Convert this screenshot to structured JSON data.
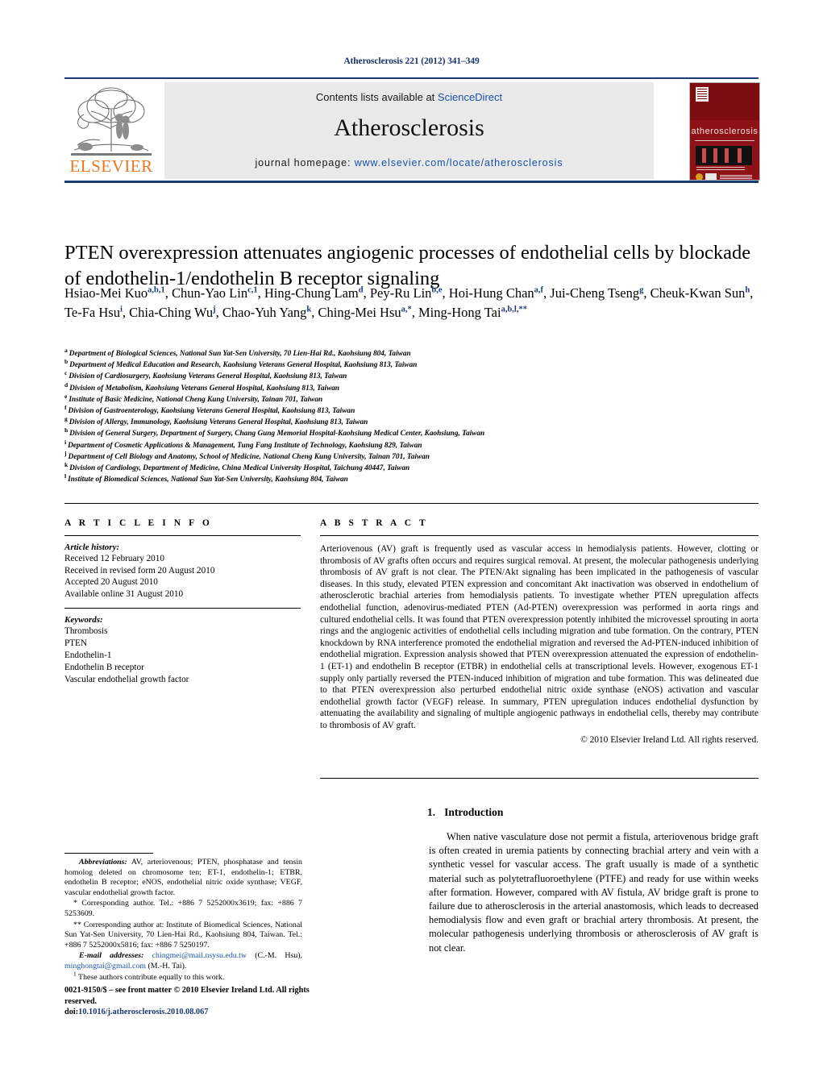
{
  "running_head": "Atherosclerosis 221 (2012) 341–349",
  "masthead": {
    "contents_prefix": "Contents lists available at",
    "sciencedirect": "ScienceDirect",
    "journal_name": "Atherosclerosis",
    "homepage_prefix": "journal homepage:",
    "homepage_url": "www.elsevier.com/locate/atherosclerosis",
    "publisher": "ELSEVIER",
    "cover_title": "atherosclerosis",
    "accent_blue": "#1a52a8",
    "rule_navy": "#1a3a73",
    "cover_red": "#8d1116",
    "elsevier_orange": "#E87722"
  },
  "article": {
    "title": "PTEN overexpression attenuates angiogenic processes of endothelial cells by blockade of endothelin-1/endothelin B receptor signaling",
    "authors": [
      {
        "name": "Hsiao-Mei Kuo",
        "sup": "a,b,1",
        "sep": ","
      },
      {
        "name": "Chun-Yao Lin",
        "sup": "c,1",
        "sep": ","
      },
      {
        "name": "Hing-Chung Lam",
        "sup": "d",
        "sep": ","
      },
      {
        "name": "Pey-Ru Lin",
        "sup": "b,e",
        "sep": ","
      },
      {
        "name": "Hoi-Hung Chan",
        "sup": "a,f",
        "sep": ","
      },
      {
        "name": "Jui-Cheng Tseng",
        "sup": "g",
        "sep": ","
      },
      {
        "name": "Cheuk-Kwan Sun",
        "sup": "h",
        "sep": ","
      },
      {
        "name": "Te-Fa Hsu",
        "sup": "i",
        "sep": ","
      },
      {
        "name": "Chia-Ching Wu",
        "sup": "j",
        "sep": ","
      },
      {
        "name": "Chao-Yuh Yang",
        "sup": "k",
        "sep": ","
      },
      {
        "name": "Ching-Mei Hsu",
        "sup": "a,*",
        "sep": ","
      },
      {
        "name": "Ming-Hong Tai",
        "sup": "a,b,l,**",
        "sep": ""
      }
    ],
    "affiliations": [
      {
        "marker": "a",
        "text": "Department of Biological Sciences, National Sun Yat-Sen University, 70 Lien-Hai Rd., Kaohsiung 804, Taiwan"
      },
      {
        "marker": "b",
        "text": "Department of Medical Education and Research, Kaohsiung Veterans General Hospital, Kaohsiung 813, Taiwan"
      },
      {
        "marker": "c",
        "text": "Division of Cardiosurgery, Kaohsiung Veterans General Hospital, Kaohsiung 813, Taiwan"
      },
      {
        "marker": "d",
        "text": "Division of Metabolism, Kaohsiung Veterans General Hospital, Kaohsiung 813, Taiwan"
      },
      {
        "marker": "e",
        "text": "Institute of Basic Medicine, National Cheng Kung University, Tainan 701, Taiwan"
      },
      {
        "marker": "f",
        "text": "Division of Gastroenterology, Kaohsiung Veterans General Hospital, Kaohsiung 813, Taiwan"
      },
      {
        "marker": "g",
        "text": "Division of Allergy, Immunology, Kaohsiung Veterans General Hospital, Kaohsiung 813, Taiwan"
      },
      {
        "marker": "h",
        "text": "Division of General Surgery, Department of Surgery, Chang Gung Memorial Hospital-Kaohsiung Medical Center, Kaohsiung, Taiwan"
      },
      {
        "marker": "i",
        "text": "Department of Cosmetic Applications & Management, Tung Fang Institute of Technology, Kaohsiung 829, Taiwan"
      },
      {
        "marker": "j",
        "text": "Department of Cell Biology and Anatomy, School of Medicine, National Cheng Kung University, Tainan 701, Taiwan"
      },
      {
        "marker": "k",
        "text": "Division of Cardiology, Department of Medicine, China Medical University Hospital, Taichung 40447, Taiwan"
      },
      {
        "marker": "l",
        "text": "Institute of Biomedical Sciences, National Sun Yat-Sen University, Kaohsiung 804, Taiwan"
      }
    ]
  },
  "article_info": {
    "heading": "A R T I C L E   I N F O",
    "history_label": "Article history:",
    "history": [
      "Received 12 February 2010",
      "Received in revised form 20 August 2010",
      "Accepted 20 August 2010",
      "Available online 31 August 2010"
    ],
    "keywords_label": "Keywords:",
    "keywords": [
      "Thrombosis",
      "PTEN",
      "Endothelin-1",
      "Endothelin B receptor",
      "Vascular endothelial growth factor"
    ]
  },
  "abstract": {
    "heading": "A B S T R A C T",
    "body": "Arteriovenous (AV) graft is frequently used as vascular access in hemodialysis patients. However, clotting or thrombosis of AV grafts often occurs and requires surgical removal. At present, the molecular pathogenesis underlying thrombosis of AV graft is not clear. The PTEN/Akt signaling has been implicated in the pathogenesis of vascular diseases. In this study, elevated PTEN expression and concomitant Akt inactivation was observed in endothelium of atherosclerotic brachial arteries from hemodialysis patients. To investigate whether PTEN upregulation affects endothelial function, adenovirus-mediated PTEN (Ad-PTEN) overexpression was performed in aorta rings and cultured endothelial cells. It was found that PTEN overexpression potently inhibited the microvessel sprouting in aorta rings and the angiogenic activities of endothelial cells including migration and tube formation. On the contrary, PTEN knockdown by RNA interference promoted the endothelial migration and reversed the Ad-PTEN-induced inhibition of endothelial migration. Expression analysis showed that PTEN overexpression attenuated the expression of endothelin-1 (ET-1) and endothelin B receptor (ETBR) in endothelial cells at transcriptional levels. However, exogenous ET-1 supply only partially reversed the PTEN-induced inhibition of migration and tube formation. This was delineated due to that PTEN overexpression also perturbed endothelial nitric oxide synthase (eNOS) activation and vascular endothelial growth factor (VEGF) release. In summary, PTEN upregulation induces endothelial dysfunction by attenuating the availability and signaling of multiple angiogenic pathways in endothelial cells, thereby may contribute to thrombosis of AV graft.",
    "copyright": "© 2010 Elsevier Ireland Ltd. All rights reserved."
  },
  "introduction": {
    "number": "1.",
    "heading": "Introduction",
    "paragraph": "When native vasculature dose not permit a fistula, arteriovenous bridge graft is often created in uremia patients by connecting brachial artery and vein with a synthetic vessel for vascular access. The graft usually is made of a synthetic material such as polytetrafluoroethylene (PTFE) and ready for use within weeks after formation. However, compared with AV fistula, AV bridge graft is prone to failure due to atherosclerosis in the arterial anastomosis, which leads to decreased hemodialysis flow and even graft or brachial artery thrombosis. At present, the molecular pathogenesis underlying thrombosis or atherosclerosis of AV graft is not clear."
  },
  "footnotes": {
    "abbrev_label": "Abbreviations:",
    "abbrev_text": "AV, arteriovenous; PTEN, phosphatase and tensin homolog deleted on chromosome ten; ET-1, endothelin-1; ETBR, endothelin B receptor; eNOS, endothelial nitric oxide synthase; VEGF, vascular endothelial growth factor.",
    "corresponding_1": "* Corresponding author. Tel.: +886 7 5252000x3619; fax: +886 7 5253609.",
    "corresponding_2": "** Corresponding author at: Institute of Biomedical Sciences, National Sun Yat-Sen University, 70 Lien-Hai Rd., Kaohsiung 804, Taiwan. Tel.: +886 7 5252000x5816; fax: +886 7 5250197.",
    "email_label": "E-mail addresses:",
    "email_1": "chingmei@mail.nsysu.edu.tw",
    "email_1_owner": "(C.-M. Hsu),",
    "email_2": "minghongtai@gmail.com",
    "email_2_owner": "(M.-H. Tai).",
    "equal_contribution": "These authors contribute equally to this work."
  },
  "footer": {
    "issn_line": "0021-9150/$ – see front matter © 2010 Elsevier Ireland Ltd. All rights reserved.",
    "doi_prefix": "doi:",
    "doi": "10.1016/j.atherosclerosis.2010.08.067"
  }
}
